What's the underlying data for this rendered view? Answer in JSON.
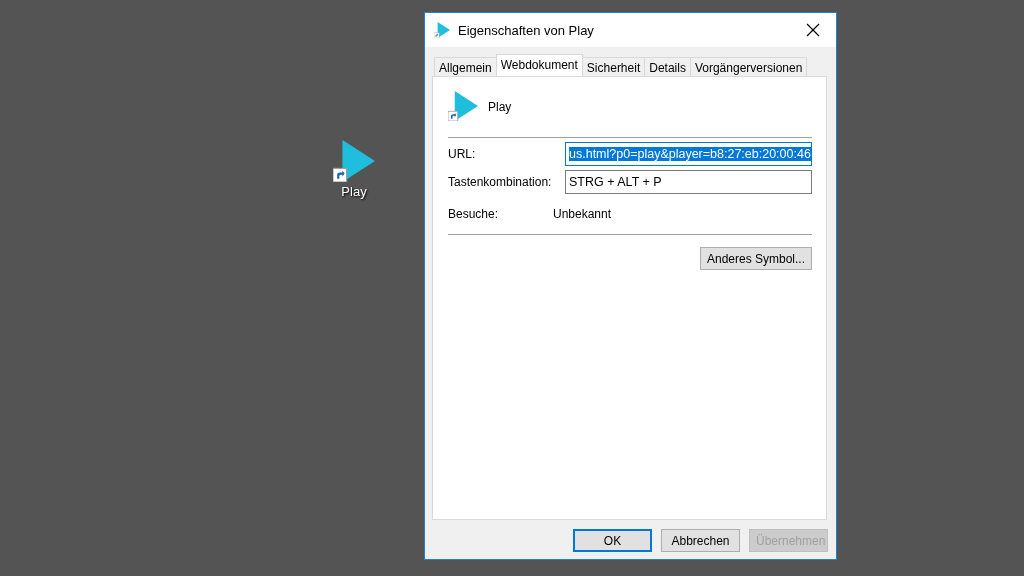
{
  "desktop_icon": {
    "label": "Play"
  },
  "window": {
    "title": "Eigenschaften von Play"
  },
  "tabs": [
    {
      "label": "Allgemein",
      "selected": false
    },
    {
      "label": "Webdokument",
      "selected": true
    },
    {
      "label": "Sicherheit",
      "selected": false
    },
    {
      "label": "Details",
      "selected": false
    },
    {
      "label": "Vorgängerversionen",
      "selected": false
    }
  ],
  "header": {
    "name": "Play"
  },
  "fields": [
    {
      "label": "URL:",
      "value": "us.html?p0=play&player=b8:27:eb:20:00:46",
      "focused": true
    },
    {
      "label": "Tastenkombination:",
      "value": "STRG + ALT + P",
      "focused": false
    }
  ],
  "visits": {
    "label": "Besuche:",
    "value": "Unbekannt"
  },
  "change_icon_button": "Anderes Symbol...",
  "buttons": [
    {
      "label": "OK",
      "default": true,
      "disabled": false
    },
    {
      "label": "Abbrechen",
      "default": false,
      "disabled": false
    },
    {
      "label": "Übernehmen",
      "default": false,
      "disabled": true
    }
  ]
}
